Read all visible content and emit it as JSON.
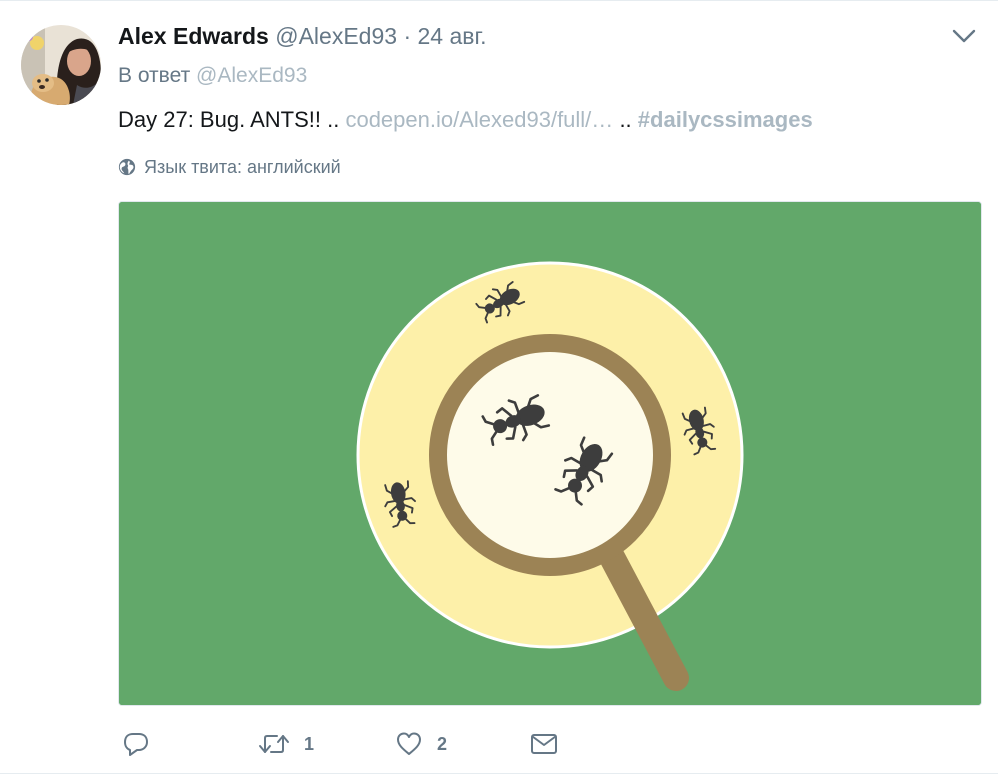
{
  "tweet": {
    "author": {
      "fullname": "Alex Edwards",
      "username": "@AlexEd93"
    },
    "separator": "·",
    "timestamp": "24 авг.",
    "reply_to": {
      "prefix": "В ответ",
      "handle": "@AlexEd93"
    },
    "text": {
      "lead": "Day 27: Bug. ANTS!! ..",
      "link": "codepen.io/Alexed93/full/…",
      "middle": "..",
      "hash_symbol": "#",
      "hashtag": "dailycssimages"
    },
    "language_label": "Язык твита: английский"
  },
  "actions": {
    "reply_count": "",
    "retweet_count": "1",
    "like_count": "2"
  },
  "icons": {
    "caret": "chevron-down-icon",
    "globe": "globe-icon",
    "reply": "reply-icon",
    "retweet": "retweet-icon",
    "like": "heart-icon",
    "message": "envelope-icon"
  },
  "colors": {
    "secondary_text": "#657786",
    "muted_link": "#aab8c2",
    "image_background": "#62a86a",
    "plate": "#fdf0a9",
    "magnifier_frame": "#9c8355",
    "lens": "#fefbe9",
    "ant": "#3d3d3d"
  }
}
